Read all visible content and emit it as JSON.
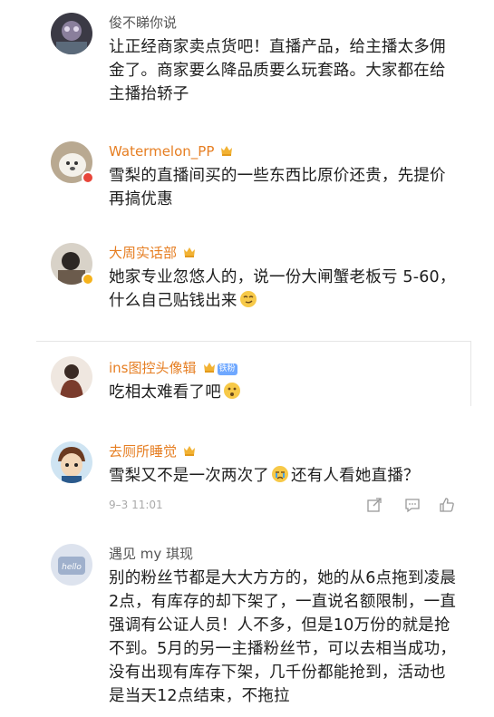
{
  "comments": [
    {
      "name": "俊不睇你说",
      "text": "让正经商家卖点货吧！直播产品，给主播太多佣金了。商家要么降品质要么玩套路。大家都在给主播抬轿子"
    },
    {
      "name": "Watermelon_PP",
      "text": "雪梨的直播间买的一些东西比原价还贵，先提价再搞优惠"
    },
    {
      "name": "大周实话部",
      "text": "她家专业忽悠人的，说一份大闸蟹老板亏 5-60，什么自己贴钱出来"
    },
    {
      "name": "ins图控头像辑",
      "tag": "铁粉",
      "text": "吃相太难看了吧"
    },
    {
      "name": "去厕所睡觉",
      "text_before": "雪梨又不是一次两次了",
      "text_after": "还有人看她直播？",
      "time": "9–3 11:01"
    },
    {
      "name": "遇见 my 琪现",
      "text": "别的粉丝节都是大大方方的，她的从6点拖到凌晨2点，有库存的却下架了，一直说名额限制，一直强调有公证人员！人不多，但是10万份的就是抢不到。5月的另一主播粉丝节，可以去相当成功，没有出现有库存下架，几千份都能抢到，活动也是当天12点结束，不拖拉"
    }
  ],
  "icons": {
    "share": "share-icon",
    "comment": "comment-icon",
    "like": "like-icon",
    "medal": "fan-medal-icon"
  },
  "colors": {
    "gold_name": "#e67e22",
    "plain_name": "#555555",
    "body_text": "#1e1e1e",
    "meta": "#aaaaaa"
  }
}
